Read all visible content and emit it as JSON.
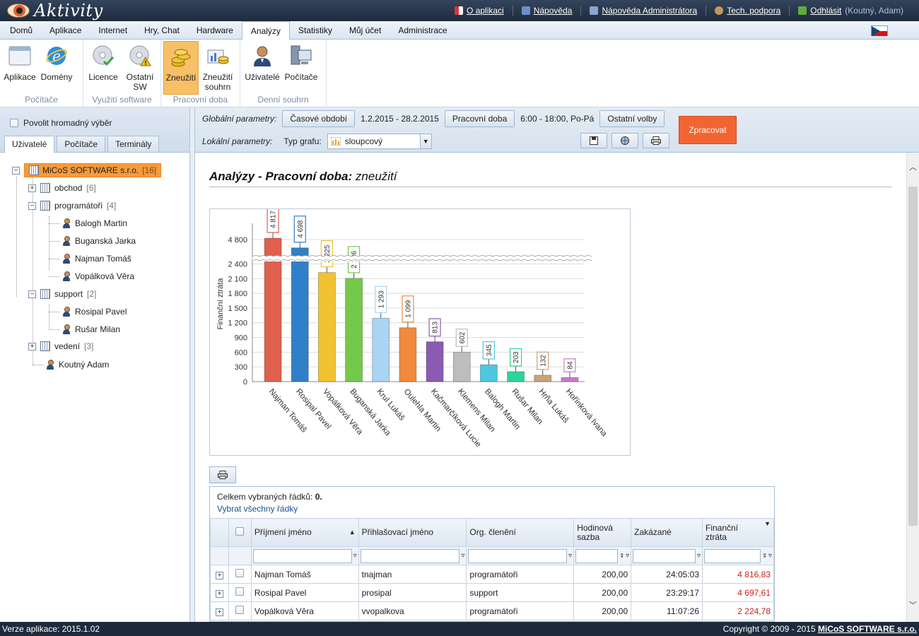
{
  "app": {
    "title": "Aktivity"
  },
  "toplinks": [
    {
      "label": "O aplikaci",
      "icon": "info-flag-icon"
    },
    {
      "label": "Nápověda",
      "icon": "help-book-icon"
    },
    {
      "label": "Nápověda Administrátora",
      "icon": "admin-help-icon"
    },
    {
      "label": "Tech. podpora",
      "icon": "support-person-icon"
    },
    {
      "label": "Odhlásit",
      "icon": "logout-icon",
      "extra": "(Koutný, Adam)"
    }
  ],
  "menu": [
    "Domů",
    "Aplikace",
    "Internet",
    "Hry, Chat",
    "Hardware",
    "Analýzy",
    "Statistiky",
    "Můj účet",
    "Administrace"
  ],
  "menu_active": "Analýzy",
  "ribbon": {
    "groups": [
      {
        "name": "Počítače",
        "buttons": [
          {
            "label": "Aplikace",
            "icon": "window-icon"
          },
          {
            "label": "Domény",
            "icon": "ie-icon"
          }
        ]
      },
      {
        "name": "Využití software",
        "buttons": [
          {
            "label": "Licence",
            "icon": "cd-check-icon"
          },
          {
            "label": "Ostatní SW",
            "icon": "cd-warning-icon"
          }
        ]
      },
      {
        "name": "Pracovní doba",
        "buttons": [
          {
            "label": "Zneužití",
            "icon": "coins-icon",
            "selected": true
          },
          {
            "label": "Zneužití souhrn",
            "icon": "coins-chart-icon"
          }
        ]
      },
      {
        "name": "Denní souhrn",
        "buttons": [
          {
            "label": "Uživatelé",
            "icon": "user-icon"
          },
          {
            "label": "Počítače",
            "icon": "computers-icon"
          }
        ]
      }
    ]
  },
  "left": {
    "bulk_select": "Povolit hromadný výběr",
    "tabs": [
      "Uživatelé",
      "Počítače",
      "Terminály"
    ],
    "tree": {
      "root": {
        "label": "MiCoS SOFTWARE s.r.o.",
        "count": "[16]"
      },
      "obchod": {
        "label": "obchod",
        "count": "[6]"
      },
      "programatori": {
        "label": "programátoři",
        "count": "[4]"
      },
      "p_users": [
        "Balogh Martin",
        "Buganská Jarka",
        "Najman Tomáš",
        "Vopálková Věra"
      ],
      "support": {
        "label": "support",
        "count": "[2]"
      },
      "s_users": [
        "Rosipal Pavel",
        "Rušar Milan"
      ],
      "vedeni": {
        "label": "vedení",
        "count": "[3]"
      },
      "single": "Koutný Adam"
    }
  },
  "params": {
    "global_label": "Globální parametry:",
    "period_btn": "Časové období",
    "period_value": "1.2.2015 - 28.2.2015",
    "worktime_btn": "Pracovní doba",
    "worktime_value": "6:00 - 18:00, Po-Pá",
    "other_btn": "Ostatní volby",
    "process_btn": "Zpracovat",
    "local_label": "Lokální parametry:",
    "chart_type_label": "Typ grafu:",
    "chart_type_value": "sloupcový"
  },
  "page": {
    "title_bold": "Analýzy - Pracovní doba:",
    "title_rest": "zneužití"
  },
  "chart_data": {
    "type": "bar",
    "ylabel": "Finanční ztráta",
    "categories": [
      "Najman Tomáš",
      "Rosipal Pavel",
      "Vopálková Věra",
      "Buganská Jarka",
      "Krul Lukáš",
      "Oulehla Martin",
      "Kačmarčíková Lucie",
      "Klemens Milan",
      "Balogh Martin",
      "Rušar Milan",
      "Hrňa Lukáš",
      "Hořínková Ivana"
    ],
    "values": [
      4817,
      4698,
      2225,
      2106,
      1293,
      1099,
      813,
      602,
      345,
      203,
      132,
      84
    ],
    "labels": [
      "4 817",
      "4 698",
      "2 225",
      "2 106",
      "1 293",
      "1 099",
      "813",
      "602",
      "345",
      "203",
      "132",
      "84"
    ],
    "colors": [
      "#e0604e",
      "#2f80c8",
      "#f1c232",
      "#74c94a",
      "#a9d4f2",
      "#f08a3c",
      "#8b5ab3",
      "#bdbdbd",
      "#4ec7e0",
      "#2ed39a",
      "#c9a27a",
      "#c87ac8"
    ],
    "yticks": [
      "0",
      "300",
      "600",
      "900",
      "1 200",
      "1 500",
      "1 800",
      "2 100",
      "2 400",
      "4 800"
    ],
    "axis_break": [
      2450,
      4600
    ],
    "ylim": [
      0,
      5000
    ],
    "grid": true
  },
  "table": {
    "selected_text": "Celkem vybraných řádků:",
    "selected_count": "0.",
    "select_all": "Vybrat všechny řádky",
    "columns": [
      "Příjmení jméno",
      "Přihlašovací jméno",
      "Org. členění",
      "Hodinová sazba",
      "Zakázané",
      "Finanční ztráta"
    ],
    "rows": [
      [
        "Najman Tomáš",
        "tnajman",
        "programátoři",
        "200,00",
        "24:05:03",
        "4 816,83"
      ],
      [
        "Rosipal Pavel",
        "prosipal",
        "support",
        "200,00",
        "23:29:17",
        "4 697,61"
      ],
      [
        "Vopálková Věra",
        "vvopalkova",
        "programátoři",
        "200,00",
        "11:07:26",
        "2 224,78"
      ]
    ]
  },
  "status": {
    "version": "Verze aplikace: 2015.1.02",
    "copyright": "Copyright © 2009 - 2015",
    "company": "MiCoS SOFTWARE s.r.o."
  }
}
